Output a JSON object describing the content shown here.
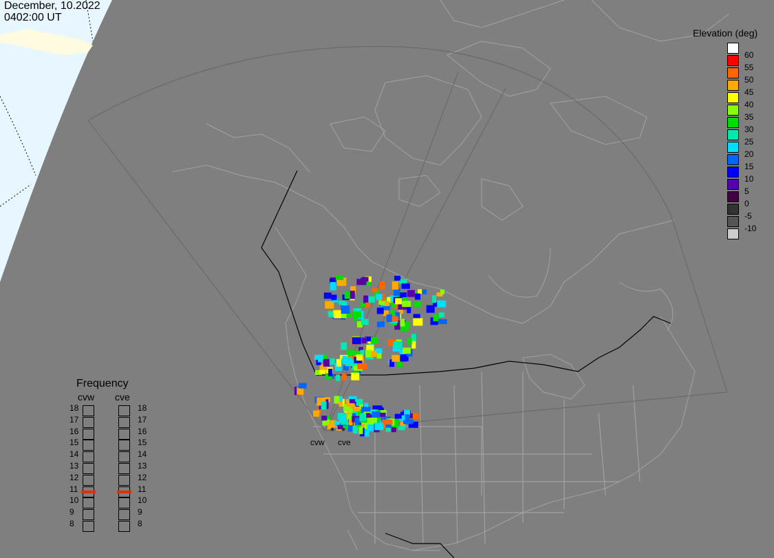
{
  "header": {
    "date": "December, 10.2022",
    "time": "0402:00 UT"
  },
  "elevation_scale": {
    "title": "Elevation (deg)",
    "levels": [
      {
        "label": "60",
        "color": "#ffffff"
      },
      {
        "label": "55",
        "color": "#ff0000"
      },
      {
        "label": "50",
        "color": "#ff6600"
      },
      {
        "label": "45",
        "color": "#ffaa00"
      },
      {
        "label": "40",
        "color": "#ffff00"
      },
      {
        "label": "35",
        "color": "#88ff00"
      },
      {
        "label": "30",
        "color": "#00dd00"
      },
      {
        "label": "25",
        "color": "#00e8b0"
      },
      {
        "label": "20",
        "color": "#00ddff"
      },
      {
        "label": "15",
        "color": "#0066ff"
      },
      {
        "label": "10",
        "color": "#0000ff"
      },
      {
        "label": "5",
        "color": "#5500aa"
      },
      {
        "label": "0",
        "color": "#440044"
      },
      {
        "label": "-5",
        "color": "#333333"
      },
      {
        "label": "-10",
        "color": "#555555"
      },
      {
        "label": "",
        "color": "#cccccc"
      }
    ]
  },
  "frequency_panel": {
    "title": "Frequency",
    "radars": [
      {
        "label": "cvw",
        "selected_mhz": 11
      },
      {
        "label": "cve",
        "selected_mhz": 11
      }
    ],
    "scale": [
      "18",
      "17",
      "16",
      "15",
      "14",
      "13",
      "12",
      "11",
      "10",
      "9",
      "8"
    ],
    "marker_color": "#e03000"
  },
  "stations": [
    {
      "label": "cvw"
    },
    {
      "label": "cve"
    }
  ]
}
